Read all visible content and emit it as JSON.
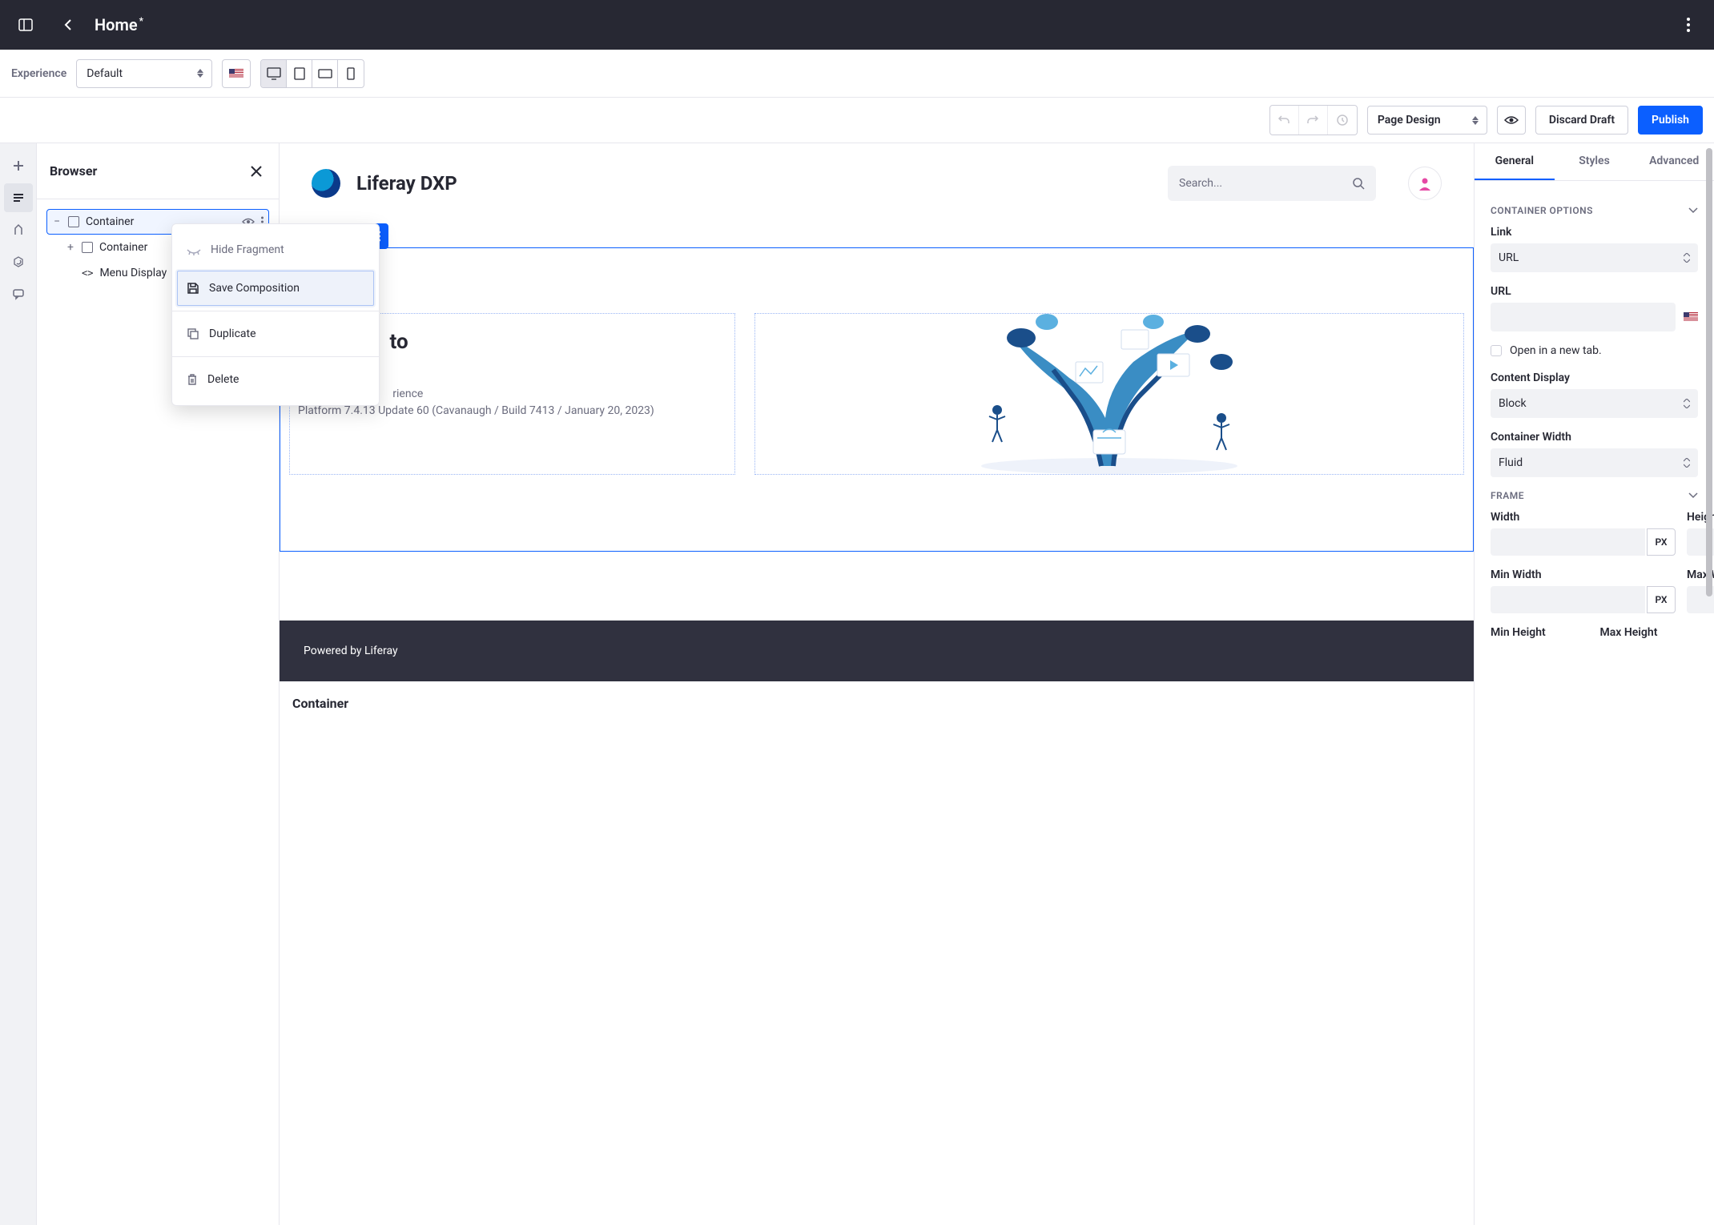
{
  "topbar": {
    "title": "Home",
    "modified": "*"
  },
  "toolbar1": {
    "experience_label": "Experience",
    "experience_value": "Default"
  },
  "toolbar2": {
    "mode_value": "Page Design",
    "discard": "Discard Draft",
    "publish": "Publish"
  },
  "browser": {
    "title": "Browser",
    "tree": [
      {
        "label": "Container"
      },
      {
        "label": "Container"
      },
      {
        "label": "Menu Display"
      }
    ]
  },
  "context_menu": {
    "hide": "Hide Fragment",
    "save": "Save Composition",
    "duplicate": "Duplicate",
    "delete": "Delete"
  },
  "canvas": {
    "brand": "Liferay DXP",
    "search_placeholder": "Search...",
    "selected_label": "Container",
    "heading_visible": "to",
    "body_line1_visible": "rience",
    "body_line2": "Platform 7.4.13 Update 60 (Cavanaugh / Build 7413 / January 20, 2023)",
    "footer": "Powered by Liferay",
    "bottom_label": "Container"
  },
  "rightpanel": {
    "tabs": {
      "general": "General",
      "styles": "Styles",
      "advanced": "Advanced"
    },
    "section_container": "CONTAINER OPTIONS",
    "link_label": "Link",
    "link_value": "URL",
    "url_label": "URL",
    "open_new_tab": "Open in a new tab.",
    "content_display_label": "Content Display",
    "content_display_value": "Block",
    "container_width_label": "Container Width",
    "container_width_value": "Fluid",
    "section_frame": "FRAME",
    "width_label": "Width",
    "height_label": "Height",
    "min_width_label": "Min Width",
    "max_width_label": "Max Width",
    "min_height_label": "Min Height",
    "max_height_label": "Max Height",
    "unit": "PX"
  }
}
